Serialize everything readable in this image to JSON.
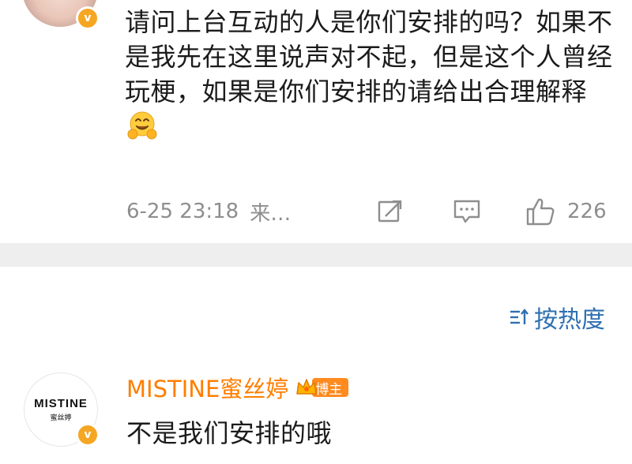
{
  "post": {
    "text": "请问上台互动的人是你们安排的吗？如果不是我先在这里说声对不起，但是这个人曾经玩梗，如果是你们安排的请给出合理解释",
    "emoji": "hugging-face-emoji",
    "timestamp": "6-25 23:18",
    "source": "来…",
    "like_count": "226"
  },
  "sort": {
    "label": "按热度"
  },
  "reply": {
    "author": "MISTINE蜜丝婷",
    "badge": "博主",
    "avatar_brand_en": "MISTINE",
    "avatar_brand_cn": "蜜丝婷",
    "text": "不是我们安排的哦"
  },
  "colors": {
    "verified_badge": "#f5a623",
    "author_name": "#ff7e00",
    "link_blue": "#2f6fb0",
    "meta_gray": "#8e8e8e",
    "band_gray": "#eeeeef"
  }
}
